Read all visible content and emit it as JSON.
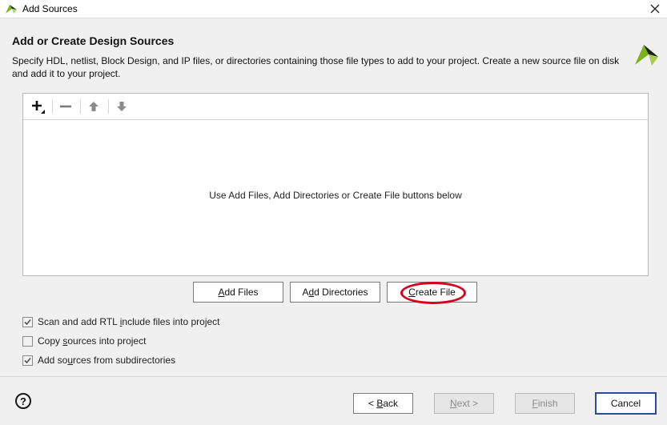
{
  "window": {
    "title": "Add Sources",
    "close_icon": "close-icon",
    "logo_icon": "vivado-logo-icon"
  },
  "header": {
    "title": "Add or Create Design Sources",
    "description": "Specify HDL, netlist, Block Design, and IP files, or directories containing those file types to add to your project. Create a new source file on disk and add it to your project."
  },
  "toolbar": {
    "add_icon": "plus-icon",
    "remove_icon": "minus-icon",
    "move_up_icon": "arrow-up-icon",
    "move_down_icon": "arrow-down-icon"
  },
  "file_list": {
    "empty_message": "Use Add Files, Add Directories or Create File buttons below"
  },
  "actions": {
    "add_files": {
      "mnemonic": "A",
      "rest": "dd Files"
    },
    "add_directories": {
      "pre": "A",
      "mnemonic": "d",
      "rest": "d Directories"
    },
    "create_file": {
      "mnemonic": "C",
      "rest": "reate File"
    }
  },
  "options": [
    {
      "label_pre": "Scan and add RTL ",
      "mnemonic": "i",
      "label_post": "nclude files into project",
      "checked": true
    },
    {
      "label_pre": "Copy ",
      "mnemonic": "s",
      "label_post": "ources into project",
      "checked": false
    },
    {
      "label_pre": "Add so",
      "mnemonic": "u",
      "label_post": "rces from subdirectories",
      "checked": true
    }
  ],
  "footer": {
    "help_icon": "help-icon",
    "help_glyph": "?",
    "back": {
      "pre": "< ",
      "mnemonic": "B",
      "rest": "ack"
    },
    "next": {
      "mnemonic": "N",
      "rest": "ext >"
    },
    "finish": {
      "mnemonic": "F",
      "rest": "inish"
    },
    "cancel": "Cancel"
  },
  "colors": {
    "highlight_ring": "#d8001b",
    "default_button_border": "#2b4d9c",
    "logo_green": "#7ab51d"
  }
}
